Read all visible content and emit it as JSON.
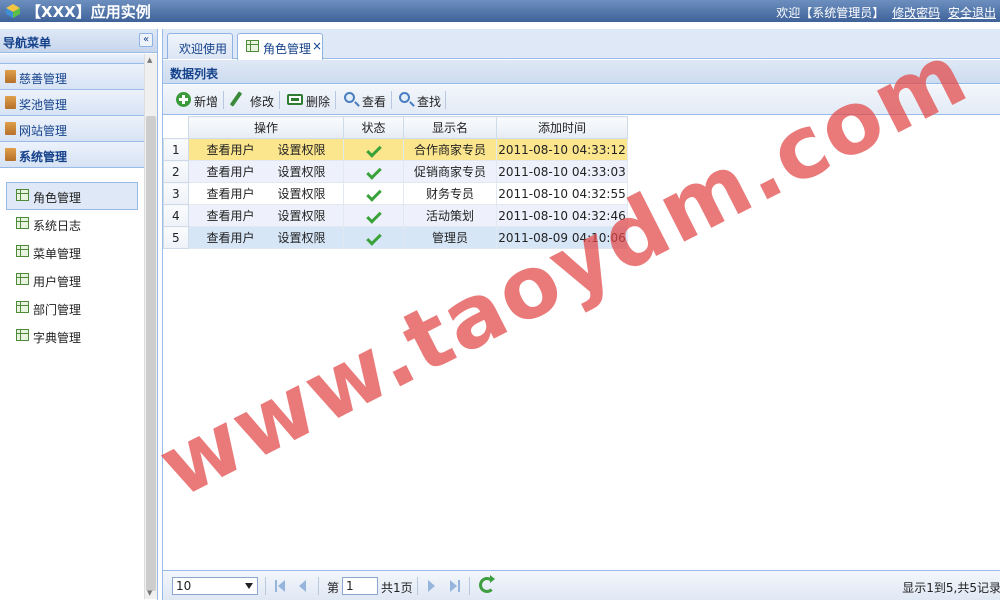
{
  "header": {
    "title": "【XXX】应用实例",
    "welcome": "欢迎【系统管理员】",
    "change_password": "修改密码",
    "logout": "安全退出"
  },
  "sidebar": {
    "title": "导航菜单",
    "collapse_glyph": "«",
    "sections": [
      {
        "label": "",
        "partial": true
      },
      {
        "label": "慈善管理"
      },
      {
        "label": "奖池管理"
      },
      {
        "label": "网站管理"
      },
      {
        "label": "系统管理",
        "active": true
      }
    ],
    "items": [
      {
        "label": "角色管理",
        "selected": true
      },
      {
        "label": "系统日志"
      },
      {
        "label": "菜单管理"
      },
      {
        "label": "用户管理"
      },
      {
        "label": "部门管理"
      },
      {
        "label": "字典管理"
      }
    ]
  },
  "tabs": [
    {
      "label": "欢迎使用"
    },
    {
      "label": "角色管理",
      "active": true,
      "close": "×"
    }
  ],
  "panel": {
    "title": "数据列表"
  },
  "toolbar": {
    "add": "新增",
    "edit": "修改",
    "delete": "删除",
    "view": "查看",
    "find": "查找"
  },
  "grid": {
    "columns": [
      "操作",
      "状态",
      "显示名",
      "添加时间"
    ],
    "rows": [
      {
        "num": "1",
        "action1": "查看用户",
        "action2": "设置权限",
        "name": "合作商家专员",
        "time": "2011-08-10 04:33:12"
      },
      {
        "num": "2",
        "action1": "查看用户",
        "action2": "设置权限",
        "name": "促销商家专员",
        "time": "2011-08-10 04:33:03"
      },
      {
        "num": "3",
        "action1": "查看用户",
        "action2": "设置权限",
        "name": "财务专员",
        "time": "2011-08-10 04:32:55"
      },
      {
        "num": "4",
        "action1": "查看用户",
        "action2": "设置权限",
        "name": "活动策划",
        "time": "2011-08-10 04:32:46"
      },
      {
        "num": "5",
        "action1": "查看用户",
        "action2": "设置权限",
        "name": "管理员",
        "time": "2011-08-09 04:10:06"
      }
    ]
  },
  "pager": {
    "page_size": "10",
    "page_prefix": "第",
    "page_value": "1",
    "page_suffix": "共1页",
    "info": "显示1到5,共5记录"
  },
  "watermark": "www.taoydm.com",
  "colors": {
    "header_top": "#6d8fbf",
    "header_bottom": "#3f629a",
    "selected_row": "#fbe58d",
    "hover_row": "#d6e6f7",
    "watermark": "#e24646"
  }
}
